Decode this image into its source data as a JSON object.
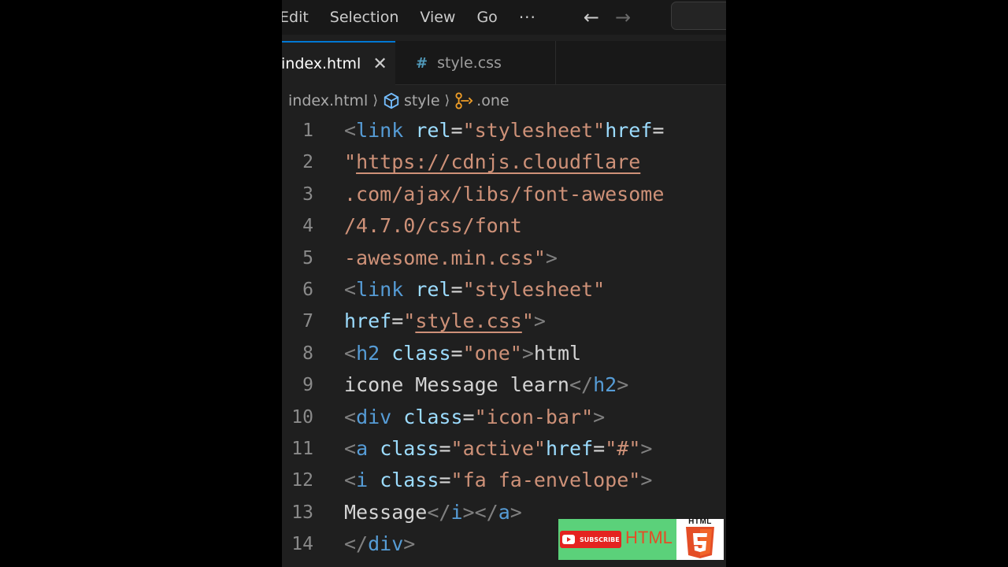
{
  "menu": {
    "items": [
      "Edit",
      "Selection",
      "View",
      "Go"
    ],
    "more": "···",
    "back_icon": "arrow-left-icon",
    "forward_icon": "arrow-right-icon"
  },
  "tabs": [
    {
      "label": "index.html",
      "active": true,
      "close": "✕"
    },
    {
      "label": "style.css",
      "active": false,
      "icon": "#"
    }
  ],
  "breadcrumb": {
    "file": "index.html",
    "symbol": "style",
    "selector": ".one"
  },
  "code": {
    "line_numbers": [
      "1",
      "2",
      "3",
      "4",
      "5",
      "6",
      "7",
      "8",
      "9",
      "10",
      "11",
      "12",
      "13",
      "14"
    ],
    "lines": [
      [
        [
          "p",
          "<"
        ],
        [
          "t",
          "link"
        ],
        [
          "w",
          " "
        ],
        [
          "a",
          "rel"
        ],
        [
          "w",
          "="
        ],
        [
          "s",
          "\"stylesheet\""
        ],
        [
          "a",
          "href"
        ],
        [
          "w",
          "="
        ]
      ],
      [
        [
          "s",
          "\""
        ],
        [
          "u",
          "https://cdnjs.cloudflare"
        ]
      ],
      [
        [
          "s",
          ".com/ajax/libs/font-awesome"
        ]
      ],
      [
        [
          "s",
          "/4.7.0/css/font"
        ]
      ],
      [
        [
          "s",
          "-awesome.min.css\""
        ],
        [
          "p",
          ">"
        ]
      ],
      [
        [
          "p",
          "<"
        ],
        [
          "t",
          "link"
        ],
        [
          "w",
          " "
        ],
        [
          "a",
          "rel"
        ],
        [
          "w",
          "="
        ],
        [
          "s",
          "\"stylesheet\""
        ]
      ],
      [
        [
          "a",
          "href"
        ],
        [
          "w",
          "="
        ],
        [
          "s",
          "\""
        ],
        [
          "u",
          "style.css"
        ],
        [
          "s",
          "\""
        ],
        [
          "p",
          ">"
        ]
      ],
      [
        [
          "p",
          "<"
        ],
        [
          "t",
          "h2"
        ],
        [
          "w",
          " "
        ],
        [
          "a",
          "class"
        ],
        [
          "w",
          "="
        ],
        [
          "s",
          "\"one\""
        ],
        [
          "p",
          ">"
        ],
        [
          "w",
          "html"
        ]
      ],
      [
        [
          "w",
          "icone Message learn"
        ],
        [
          "p",
          "</"
        ],
        [
          "t",
          "h2"
        ],
        [
          "p",
          ">"
        ]
      ],
      [
        [
          "p",
          "<"
        ],
        [
          "t",
          "div"
        ],
        [
          "w",
          " "
        ],
        [
          "a",
          "class"
        ],
        [
          "w",
          "="
        ],
        [
          "s",
          "\"icon-bar\""
        ],
        [
          "p",
          ">"
        ]
      ],
      [
        [
          "p",
          "<"
        ],
        [
          "t",
          "a"
        ],
        [
          "w",
          " "
        ],
        [
          "a",
          "class"
        ],
        [
          "w",
          "="
        ],
        [
          "s",
          "\"active\""
        ],
        [
          "a",
          "href"
        ],
        [
          "w",
          "="
        ],
        [
          "s",
          "\"#\""
        ],
        [
          "p",
          ">"
        ]
      ],
      [
        [
          "p",
          "<"
        ],
        [
          "t",
          "i"
        ],
        [
          "w",
          " "
        ],
        [
          "a",
          "class"
        ],
        [
          "w",
          "="
        ],
        [
          "s",
          "\"fa fa-envelope\""
        ],
        [
          "p",
          ">"
        ]
      ],
      [
        [
          "w",
          "Message"
        ],
        [
          "p",
          "</"
        ],
        [
          "t",
          "i"
        ],
        [
          "p",
          "></"
        ],
        [
          "t",
          "a"
        ],
        [
          "p",
          ">"
        ]
      ],
      [
        [
          "p",
          "</"
        ],
        [
          "t",
          "div"
        ],
        [
          "p",
          ">"
        ]
      ]
    ]
  },
  "badge": {
    "subscribe": "SUBSCRIBE",
    "html_text": "HTML",
    "html5_word": "HTML",
    "colors": {
      "green": "#5bd17a",
      "youtube_red": "#e42320",
      "html5_orange": "#e44d26"
    }
  },
  "theme": {
    "editor_bg": "#1f1f1f",
    "chrome_bg": "#181818",
    "accent": "#0078d4"
  }
}
